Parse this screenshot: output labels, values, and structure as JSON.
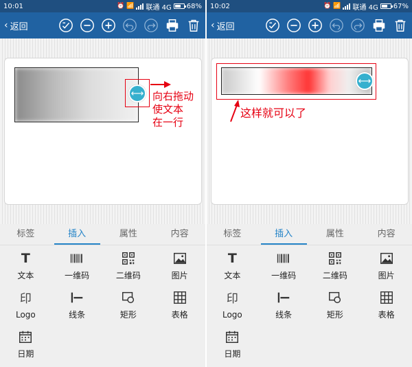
{
  "screens": [
    {
      "status": {
        "time": "10:01",
        "carrier": "联通 4G",
        "battery": "68%",
        "battery_level": 0.68
      },
      "nav": {
        "back_label": "返回"
      },
      "annotation": {
        "text_lines": [
          "向右拖动",
          "使文本",
          "在一行"
        ]
      }
    },
    {
      "status": {
        "time": "10:02",
        "carrier": "联通 4G",
        "battery": "67%",
        "battery_level": 0.67
      },
      "nav": {
        "back_label": "返回"
      },
      "annotation": {
        "text": "这样就可以了"
      }
    }
  ],
  "tabs": [
    "标签",
    "插入",
    "属性",
    "内容"
  ],
  "active_tab": "插入",
  "insert_items": [
    {
      "label": "文本",
      "icon": "text-icon"
    },
    {
      "label": "一维码",
      "icon": "barcode-icon"
    },
    {
      "label": "二维码",
      "icon": "qrcode-icon"
    },
    {
      "label": "图片",
      "icon": "image-icon"
    },
    {
      "label": "Logo",
      "icon": "logo-icon",
      "glyph": "印"
    },
    {
      "label": "线条",
      "icon": "line-icon"
    },
    {
      "label": "矩形",
      "icon": "rectangle-icon"
    },
    {
      "label": "表格",
      "icon": "table-icon"
    },
    {
      "label": "日期",
      "icon": "date-icon"
    }
  ],
  "colors": {
    "status_bar": "#1f4f80",
    "nav_bar": "#2062a2",
    "accent": "#2584c8",
    "annotation_red": "#e60012",
    "handle": "#36b0ce"
  }
}
